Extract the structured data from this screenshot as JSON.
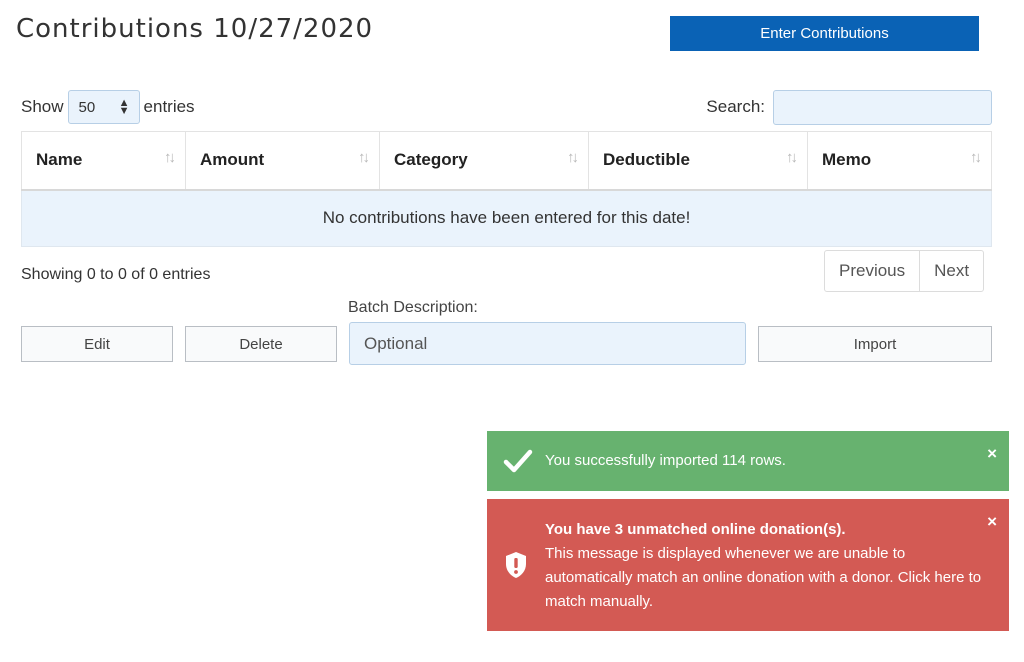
{
  "page": {
    "title": "Contributions 10/27/2020",
    "enter_button": "Enter Contributions"
  },
  "table_controls": {
    "show_label": "Show",
    "page_length": "50",
    "entries_label": "entries",
    "search_label": "Search:",
    "search_value": ""
  },
  "table": {
    "columns": [
      "Name",
      "Amount",
      "Category",
      "Deductible",
      "Memo"
    ],
    "empty_message": "No contributions have been entered for this date!"
  },
  "footer": {
    "info": "Showing 0 to 0 of 0 entries",
    "previous": "Previous",
    "next": "Next"
  },
  "batch": {
    "label": "Batch Description:",
    "placeholder": "Optional",
    "edit_button": "Edit",
    "delete_button": "Delete",
    "import_button": "Import"
  },
  "alerts": {
    "success": {
      "message": "You successfully imported 114 rows.",
      "close": "×",
      "icon": "check-icon",
      "color": "#67b26f"
    },
    "danger": {
      "title": "You have 3 unmatched online donation(s).",
      "message": "This message is displayed whenever we are unable to automatically match an online donation with a donor. Click here to match manually.",
      "close": "×",
      "icon": "shield-alert-icon",
      "color": "#d35a54"
    }
  },
  "colors": {
    "primary": "#0a62b5",
    "input_bg": "#eaf3fc"
  }
}
